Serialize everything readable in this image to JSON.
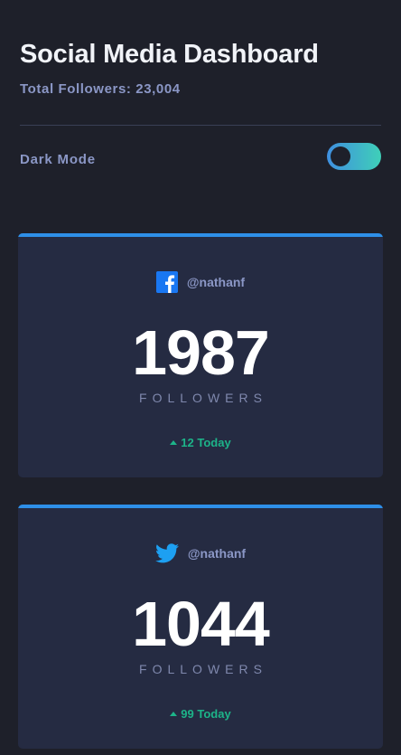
{
  "header": {
    "title": "Social Media Dashboard",
    "total_followers": "Total Followers: 23,004"
  },
  "settings": {
    "dark_mode_label": "Dark Mode"
  },
  "colors": {
    "background": "#1e202a",
    "card": "#252b42",
    "accent_blue": "#2e8fe8",
    "toggle_gradient_start": "#3f8fe0",
    "toggle_gradient_end": "#3fd0b8",
    "positive": "#1db489",
    "muted_text": "#8b97c6"
  },
  "cards": [
    {
      "platform_icon": "facebook-icon",
      "handle": "@nathanf",
      "count": "1987",
      "label": "FOLLOWERS",
      "delta": "12 Today"
    },
    {
      "platform_icon": "twitter-icon",
      "handle": "@nathanf",
      "count": "1044",
      "label": "FOLLOWERS",
      "delta": "99 Today"
    }
  ]
}
